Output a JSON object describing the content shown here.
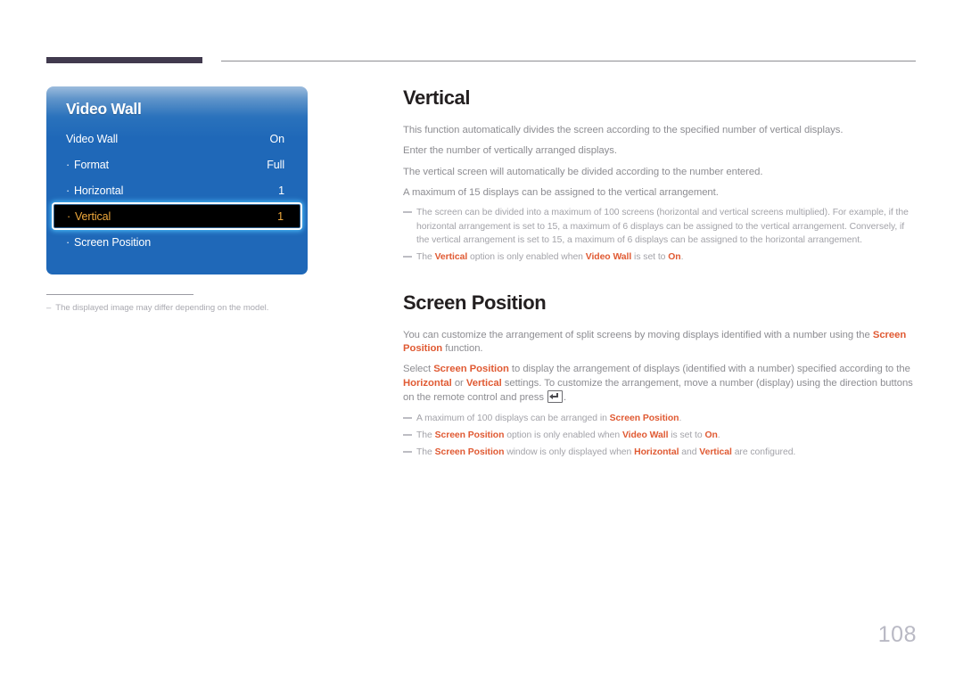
{
  "page": {
    "number": "108"
  },
  "osd": {
    "title": "Video Wall",
    "rows": [
      {
        "label": "Video Wall",
        "value": "On",
        "sub": false,
        "selected": false
      },
      {
        "label": "Format",
        "value": "Full",
        "sub": true,
        "selected": false
      },
      {
        "label": "Horizontal",
        "value": "1",
        "sub": true,
        "selected": false
      },
      {
        "label": "Vertical",
        "value": "1",
        "sub": true,
        "selected": true
      },
      {
        "label": "Screen Position",
        "value": "",
        "sub": true,
        "selected": false
      }
    ],
    "note": {
      "marker": "–",
      "text": "The displayed image may differ depending on the model."
    }
  },
  "content": {
    "vertical": {
      "heading": "Vertical",
      "paragraphs": [
        "This function automatically divides the screen according to the specified number of vertical displays.",
        "Enter the number of vertically arranged displays.",
        "The vertical screen will automatically be divided according to the number entered.",
        "A maximum of 15 displays can be assigned to the vertical arrangement."
      ],
      "notes": [
        {
          "parts": [
            {
              "text": "The screen can be divided into a maximum of 100 screens (horizontal and vertical screens multiplied). For example, if the horizontal arrangement is set to 15, a maximum of 6 displays can be assigned to the vertical arrangement. Conversely, if the vertical arrangement is set to 15, a maximum of 6 displays can be assigned to the horizontal arrangement.",
              "accent": false
            }
          ]
        },
        {
          "parts": [
            {
              "text": "The ",
              "accent": false
            },
            {
              "text": "Vertical",
              "accent": true
            },
            {
              "text": " option is only enabled when ",
              "accent": false
            },
            {
              "text": "Video Wall",
              "accent": true
            },
            {
              "text": " is set to ",
              "accent": false
            },
            {
              "text": "On",
              "accent": true
            },
            {
              "text": ".",
              "accent": false
            }
          ]
        }
      ]
    },
    "screen_position": {
      "heading": "Screen Position",
      "paragraph1": {
        "parts": [
          {
            "text": "You can customize the arrangement of split screens by moving displays identified with a number using the ",
            "accent": false
          },
          {
            "text": "Screen Position",
            "accent": true
          },
          {
            "text": " function.",
            "accent": false
          }
        ]
      },
      "paragraph2": {
        "parts": [
          {
            "text": "Select ",
            "accent": false
          },
          {
            "text": "Screen Position",
            "accent": true
          },
          {
            "text": " to display the arrangement of displays (identified with a number) specified according to the ",
            "accent": false
          },
          {
            "text": "Horizontal",
            "accent": true
          },
          {
            "text": " or ",
            "accent": false
          },
          {
            "text": "Vertical",
            "accent": true
          },
          {
            "text": " settings. To customize the arrangement, move a number (display) using the direction buttons on the remote control and press ",
            "accent": false
          }
        ],
        "trailing": "."
      },
      "notes": [
        {
          "parts": [
            {
              "text": "A maximum of 100 displays can be arranged in ",
              "accent": false
            },
            {
              "text": "Screen Position",
              "accent": true
            },
            {
              "text": ".",
              "accent": false
            }
          ]
        },
        {
          "parts": [
            {
              "text": "The ",
              "accent": false
            },
            {
              "text": "Screen Position",
              "accent": true
            },
            {
              "text": " option is only enabled when ",
              "accent": false
            },
            {
              "text": "Video Wall",
              "accent": true
            },
            {
              "text": " is set to ",
              "accent": false
            },
            {
              "text": "On",
              "accent": true
            },
            {
              "text": ".",
              "accent": false
            }
          ]
        },
        {
          "parts": [
            {
              "text": "The ",
              "accent": false
            },
            {
              "text": "Screen Position",
              "accent": true
            },
            {
              "text": " window is only displayed when ",
              "accent": false
            },
            {
              "text": "Horizontal",
              "accent": true
            },
            {
              "text": " and ",
              "accent": false
            },
            {
              "text": "Vertical",
              "accent": true
            },
            {
              "text": " are configured.",
              "accent": false
            }
          ]
        }
      ]
    }
  },
  "colors": {
    "accent": "#e05a33",
    "osd_blue": "#1f68b8",
    "header_bar": "#413a4e",
    "selected_text": "#f0a93c"
  }
}
